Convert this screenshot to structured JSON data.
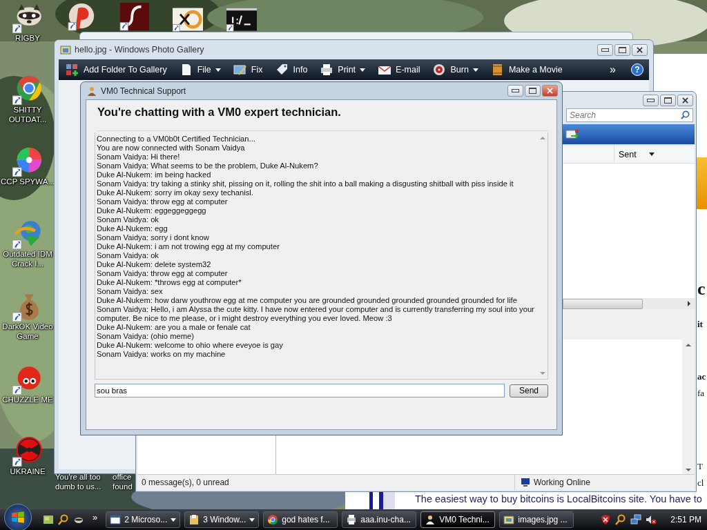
{
  "desktop_icons": [
    {
      "label": "RIGBY"
    },
    {
      "label": "SHITTY OUTDAT..."
    },
    {
      "label": "CCP SPYWA..."
    },
    {
      "label": "Outdated IDM Crack I..."
    },
    {
      "label": "DarkOK Video Game"
    },
    {
      "label": "CHUZZLE ME"
    },
    {
      "label": "UKRAINE"
    }
  ],
  "desktop_labels": [
    {
      "label": "You're all too dumb to us..."
    },
    {
      "label": "office found"
    }
  ],
  "browser_page": {
    "fragments": [
      "c",
      "it",
      "ac",
      "fa",
      "T",
      "cl"
    ],
    "text": "The easiest way to buy bitcoins is LocalBitcoins site. You have to"
  },
  "photo_gallery": {
    "title": "hello.jpg - Windows Photo Gallery",
    "toolbar": [
      {
        "label": "Add Folder To Gallery",
        "dropdown": false
      },
      {
        "label": "File",
        "dropdown": true
      },
      {
        "label": "Fix",
        "dropdown": false
      },
      {
        "label": "Info",
        "dropdown": false
      },
      {
        "label": "Print",
        "dropdown": true
      },
      {
        "label": "E-mail",
        "dropdown": false
      },
      {
        "label": "Burn",
        "dropdown": true
      },
      {
        "label": "Make a Movie",
        "dropdown": false
      }
    ],
    "overflow": "»",
    "help": "?"
  },
  "mail": {
    "search_placeholder": "Search",
    "column": "Sent",
    "status": "0 message(s), 0 unread",
    "connection": "Working Online"
  },
  "chat": {
    "title": "VM0 Technical Support",
    "heading": "You're chatting with a VM0 expert technician.",
    "messages": [
      "Connecting to a VM0b0t Certified Technician...",
      "You are now connected with Sonam Vaidya",
      "Sonam Vaidya: Hi there!",
      "Sonam Vaidya: What seems to be the problem, Duke Al-Nukem?",
      "Duke Al-Nukem: im being hacked",
      "Sonam Vaidya: try taking a stinky shit, pissing on it, rolling the shit into a ball making a disgusting shitball with piss inside it",
      "Duke Al-Nukem: sorry im okay sexy techanisl.",
      "Sonam Vaidya: throw egg at computer",
      "Duke Al-Nukem: eggeggeggegg",
      "Sonam Vaidya: ok",
      "Duke Al-Nukem: egg",
      "Sonam Vaidya: sorry i dont know",
      "Duke Al-Nukem: i am not trowing egg at my computer",
      "Sonam Vaidya: ok",
      "Duke Al-Nukem: delete system32",
      "Sonam Vaidya: throw egg at computer",
      "Duke Al-Nukem: *throws egg at computer*",
      "Sonam Vaidya: sex",
      "Duke Al-Nukem: how darw youthrow egg at me computer you are grounded grounded grounded grounded grounded for life",
      "Sonam Vaidya: Hello, i am Alyssa the cute kitty. I have now entered your computer and is currently transferring my soul into your computer. Be nice to me please, or i might destroy everything you ever loved. Meow :3",
      "Duke Al-Nukem: are you a male or fenale cat",
      "Sonam Vaidya: (ohio meme)",
      "Duke Al-Nukem: welcome to ohio where eveyoe is gay",
      "Sonam Vaidya: works on my machine"
    ],
    "input": "sou bras",
    "send": "Send"
  },
  "taskbar": {
    "overflow": "»",
    "tasks": [
      {
        "label": "2 Microso...",
        "selected": false,
        "grouped": true
      },
      {
        "label": "3 Window...",
        "selected": false,
        "grouped": true
      },
      {
        "label": "god hates f...",
        "selected": false,
        "grouped": false
      },
      {
        "label": "aaa.inu-cha...",
        "selected": false,
        "grouped": false
      },
      {
        "label": "VM0 Techni...",
        "selected": true,
        "grouped": false
      },
      {
        "label": "images.jpg ...",
        "selected": false,
        "grouped": false
      }
    ],
    "clock": "2:51 PM"
  }
}
